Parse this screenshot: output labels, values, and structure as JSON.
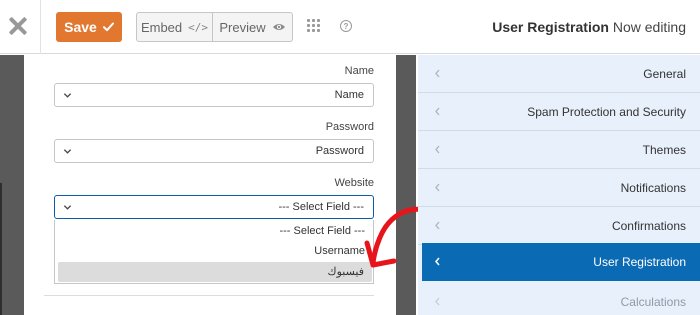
{
  "toolbar": {
    "save_label": "Save",
    "embed_label": "Embed",
    "embed_icon": "</>",
    "preview_label": "Preview",
    "help_glyph": "?",
    "form_title": "User Registration",
    "editing_status": "Now editing"
  },
  "form": {
    "fields": [
      {
        "label": "Name",
        "value": "Name"
      },
      {
        "label": "Password",
        "value": "Password"
      },
      {
        "label": "Website",
        "value": "--- Select Field ---"
      }
    ],
    "dropdown_options": [
      "--- Select Field ---",
      "Username",
      "فيسبوك"
    ]
  },
  "sidebar": {
    "items": [
      {
        "label": "General"
      },
      {
        "label": "Spam Protection and Security"
      },
      {
        "label": "Themes"
      },
      {
        "label": "Notifications"
      },
      {
        "label": "Confirmations"
      },
      {
        "label": "User Registration"
      },
      {
        "label": "Calculations"
      }
    ]
  },
  "colors": {
    "save_button": "#e27730",
    "active_item": "#0b6ab4",
    "sidebar_bg": "#e8f0fb",
    "annotation": "#e8141c"
  },
  "icons": [
    "close-icon",
    "checkmark-icon",
    "code-icon",
    "eye-icon",
    "grid-icon",
    "help-icon",
    "chevron-down-icon",
    "chevron-left-icon"
  ]
}
